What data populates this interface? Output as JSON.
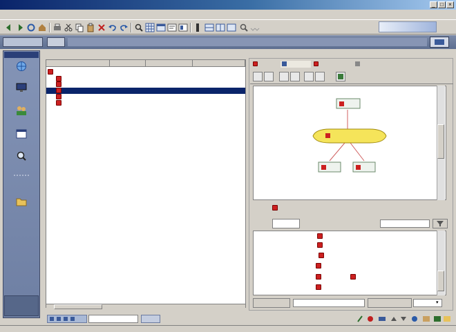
{
  "window": {
    "title": "",
    "controls": [
      "minimize",
      "maximize",
      "close"
    ],
    "colors": {
      "titlebar": "#0a246a",
      "accent_red": "#cc2020",
      "selection": "#0a246a",
      "highlight_node": "#f5e45a"
    }
  },
  "menubar": {
    "items": [
      "",
      "",
      "",
      "",
      "",
      ""
    ]
  },
  "toolbar": {
    "icons": [
      "back-icon",
      "forward-icon",
      "refresh-icon",
      "home-icon",
      "print-icon",
      "cut-icon",
      "copy-icon",
      "paste-icon",
      "delete-icon",
      "undo-icon",
      "redo-icon",
      "find-icon",
      "grid-icon",
      "layout-icon",
      "zoom-icon",
      "settings-icon",
      "help-icon"
    ],
    "brand_text": ""
  },
  "address": {
    "tab_label": "",
    "mode_label": "",
    "value": ""
  },
  "rail": {
    "header": "",
    "items": [
      {
        "icon": "globe-icon",
        "label": ""
      },
      {
        "icon": "monitor-icon",
        "label": ""
      },
      {
        "icon": "users-icon",
        "label": ""
      },
      {
        "icon": "calendar-icon",
        "label": ""
      },
      {
        "icon": "search-icon",
        "label": ""
      },
      {
        "icon": "tools-icon",
        "label": ""
      },
      {
        "icon": "folder-icon",
        "label": ""
      }
    ],
    "bottom_label": ""
  },
  "left_panel": {
    "tabs": [
      "",
      "",
      "",
      ""
    ],
    "columns": [
      "",
      "",
      "",
      ""
    ],
    "rows": [
      {
        "name": "",
        "col2": "",
        "selected": false,
        "indent": 0
      },
      {
        "name": "",
        "col2": "",
        "selected": false,
        "indent": 1
      },
      {
        "name": "",
        "col2": "",
        "selected": false,
        "indent": 1
      },
      {
        "name": "",
        "col2": "",
        "selected": true,
        "indent": 1
      },
      {
        "name": "",
        "col2": "",
        "selected": false,
        "indent": 1
      },
      {
        "name": "",
        "col2": "",
        "selected": false,
        "indent": 1
      }
    ]
  },
  "right_panel": {
    "tabs": [
      "",
      "",
      "",
      ""
    ],
    "toolbar_icons": [
      "layout-icon",
      "tree-icon",
      "zoom-in-icon",
      "zoom-out-icon",
      "fit-icon",
      "export-icon",
      "image-icon"
    ],
    "graph": {
      "nodes": [
        {
          "id": "top",
          "label": "",
          "highlighted": false
        },
        {
          "id": "center",
          "label": "",
          "highlighted": true
        },
        {
          "id": "left",
          "label": "",
          "highlighted": false
        },
        {
          "id": "right",
          "label": "",
          "highlighted": false
        }
      ],
      "edges": [
        [
          "top",
          "center"
        ],
        [
          "center",
          "left"
        ],
        [
          "center",
          "right"
        ]
      ]
    },
    "info_label": "",
    "info_value": "",
    "lower_tabs": [
      "",
      ""
    ],
    "lower_search": "",
    "list_items": [
      "",
      "",
      "",
      "",
      "",
      "",
      ""
    ],
    "bottom_fields": [
      "",
      "",
      "",
      ""
    ]
  },
  "statusbar": {
    "text": ""
  }
}
